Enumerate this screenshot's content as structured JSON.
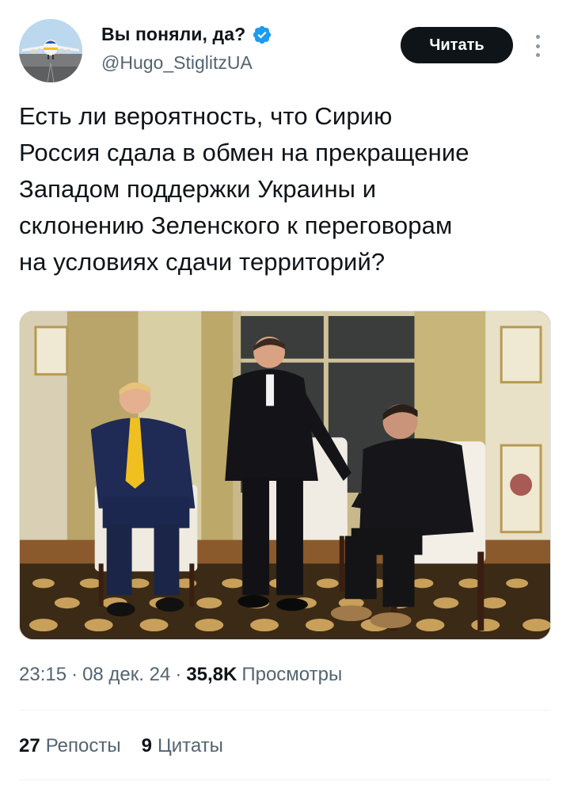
{
  "author": {
    "name": "Вы поняли, да?",
    "handle": "@Hugo_StiglitzUA",
    "verified": true,
    "avatar_icon": "airplane-avatar-icon"
  },
  "follow_button": {
    "label": "Читать"
  },
  "more_icon": "more-vertical-icon",
  "tweet": {
    "text": "Есть ли вероятность, что Сирию\nРоссия сдала в обмен на прекращение\nЗападом поддержки Украины и\nсклонению Зеленского к переговорам\nна условиях сдачи территорий?"
  },
  "meta": {
    "time": "23:15",
    "date": "08 дек. 24",
    "separator": "·",
    "views_count": "35,8K",
    "views_label": "Просмотры"
  },
  "stats": {
    "reposts_count": "27",
    "reposts_label": "Репосты",
    "quotes_count": "9",
    "quotes_label": "Цитаты"
  },
  "colors": {
    "text_primary": "#0f1419",
    "text_secondary": "#536471",
    "verified_blue": "#1d9bf0",
    "button_bg": "#0f1419",
    "divider": "#eff3f4"
  }
}
